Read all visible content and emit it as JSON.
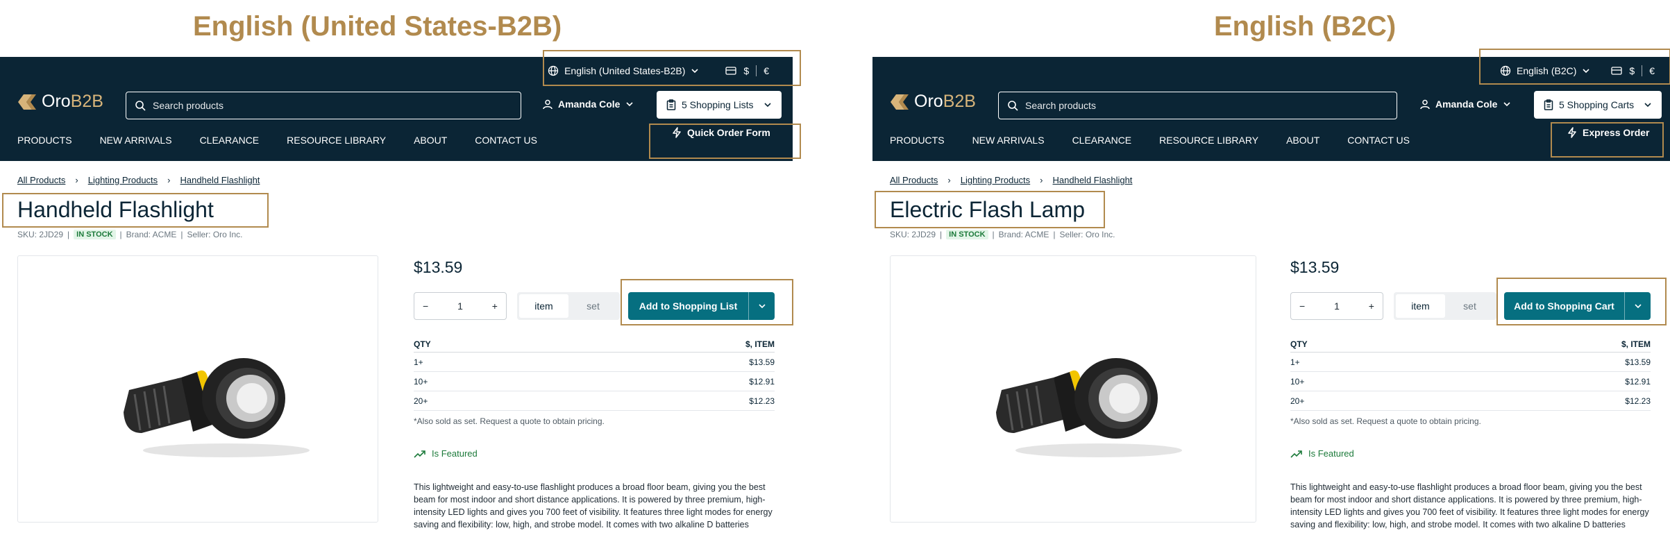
{
  "left": {
    "caption": "English (United States-B2B)",
    "language": "English (United States-B2B)",
    "currencies": [
      "$",
      "€"
    ],
    "logo": {
      "oro": "Oro",
      "b2b": "B2B"
    },
    "search_placeholder": "Search products",
    "user": "Amanda Cole",
    "cart_label": "5 Shopping Lists",
    "nav": [
      "PRODUCTS",
      "NEW ARRIVALS",
      "CLEARANCE",
      "RESOURCE LIBRARY",
      "ABOUT",
      "CONTACT US"
    ],
    "quick_label": "Quick Order Form",
    "breadcrumb": [
      "All Products",
      "Lighting Products",
      "Handheld Flashlight"
    ],
    "title": "Handheld Flashlight",
    "sku": "SKU: 2JD29",
    "stock": "IN STOCK",
    "brand": "Brand: ACME",
    "seller": "Seller: Oro Inc.",
    "price": "$13.59",
    "qty": "1",
    "units": [
      "item",
      "set"
    ],
    "add_label": "Add to Shopping List",
    "table_header": {
      "qty": "QTY",
      "price": "$, ITEM"
    },
    "tiers": [
      {
        "qty": "1+",
        "price": "$13.59"
      },
      {
        "qty": "10+",
        "price": "$12.91"
      },
      {
        "qty": "20+",
        "price": "$12.23"
      }
    ],
    "note": "*Also sold as set. Request a quote to obtain pricing.",
    "featured": "Is Featured",
    "description": "This lightweight and easy-to-use flashlight produces a broad floor beam, giving you the best beam for most indoor and short distance applications. It is powered by three premium, high-intensity LED lights and gives you 700 feet of visibility. It features three light modes for energy saving and flexibility: low, high, and strobe model. It comes with two alkaline D batteries"
  },
  "right": {
    "caption": "English (B2C)",
    "language": "English (B2C)",
    "currencies": [
      "$",
      "€"
    ],
    "logo": {
      "oro": "Oro",
      "b2b": "B2B"
    },
    "search_placeholder": "Search products",
    "user": "Amanda Cole",
    "cart_label": "5 Shopping Carts",
    "nav": [
      "PRODUCTS",
      "NEW ARRIVALS",
      "CLEARANCE",
      "RESOURCE LIBRARY",
      "ABOUT",
      "CONTACT US"
    ],
    "quick_label": "Express Order",
    "breadcrumb": [
      "All Products",
      "Lighting Products",
      "Handheld Flashlight"
    ],
    "title": "Electric Flash Lamp",
    "sku": "SKU: 2JD29",
    "stock": "IN STOCK",
    "brand": "Brand: ACME",
    "seller": "Seller: Oro Inc.",
    "price": "$13.59",
    "qty": "1",
    "units": [
      "item",
      "set"
    ],
    "add_label": "Add to Shopping Cart",
    "table_header": {
      "qty": "QTY",
      "price": "$, ITEM"
    },
    "tiers": [
      {
        "qty": "1+",
        "price": "$13.59"
      },
      {
        "qty": "10+",
        "price": "$12.91"
      },
      {
        "qty": "20+",
        "price": "$12.23"
      }
    ],
    "note": "*Also sold as set. Request a quote to obtain pricing.",
    "featured": "Is Featured",
    "description": "This lightweight and easy-to-use flashlight produces a broad floor beam, giving you the best beam for most indoor and short distance applications. It is powered by three premium, high-intensity LED lights and gives you 700 feet of visibility. It features three light modes for energy saving and flexibility: low, high, and strobe model. It comes with two alkaline D batteries"
  },
  "colors": {
    "header_bg": "#0b2535",
    "accent": "#066f80",
    "highlight_border": "#b18a4e",
    "logo_accent": "#d7b47a",
    "in_stock": "#1c7a3a"
  },
  "icons": [
    "globe-icon",
    "credit-card-icon",
    "chevron-down-icon",
    "search-icon",
    "user-icon",
    "clipboard-icon",
    "lightning-icon",
    "minus-icon",
    "plus-icon",
    "trending-up-icon",
    "chevron-right-icon"
  ]
}
